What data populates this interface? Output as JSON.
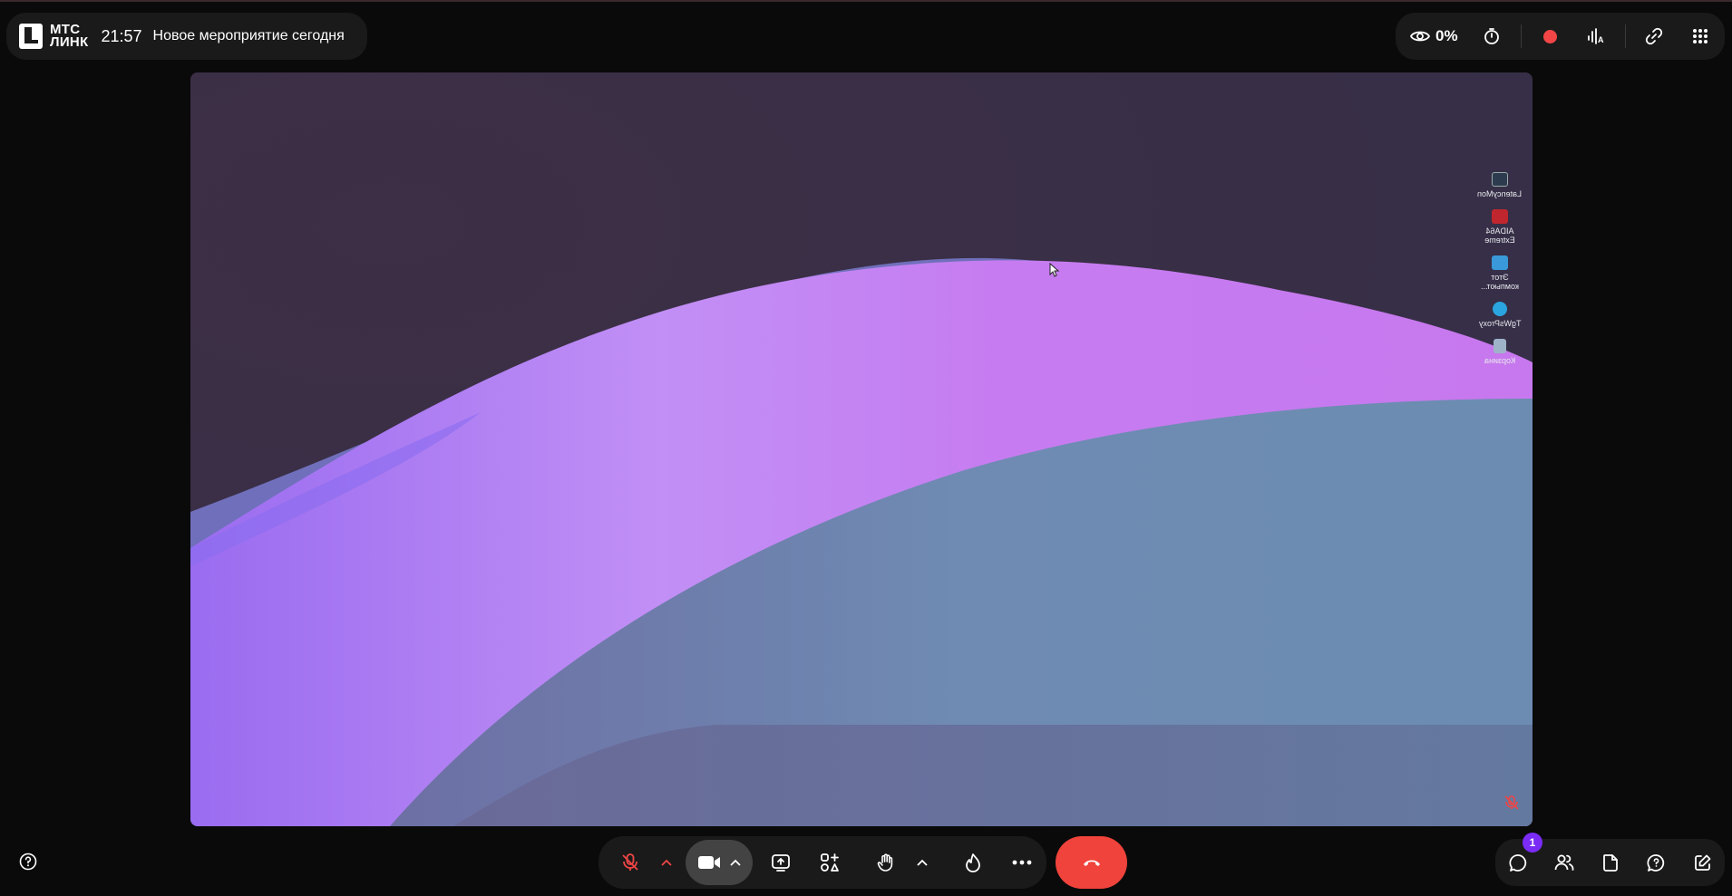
{
  "app": {
    "logo_text": "МТС\nЛИНК",
    "time": "21:57",
    "event_title": "Новое мероприятие сегодня"
  },
  "top_right": {
    "viewers_percent": "0%",
    "record_color": "#f24646"
  },
  "desktop_icons": [
    {
      "label": "LatencyMon",
      "icon": "latencymon-icon",
      "color": "#2d3b4e"
    },
    {
      "label": "AIDA64 Extreme",
      "icon": "aida64-icon",
      "color": "#c0262d"
    },
    {
      "label": "Этот компьют...",
      "icon": "this-pc-icon",
      "color": "#3a9ad9"
    },
    {
      "label": "TgWsProxy",
      "icon": "telegram-icon",
      "color": "#2aa5e0"
    },
    {
      "label": "Корзина",
      "icon": "recycle-bin-icon",
      "color": "#9fb3c8"
    }
  ],
  "bottom": {
    "chat_unread_count": "1",
    "end_call_color": "#f0433c",
    "mic_muted_color": "#f04646",
    "badge_color": "#7a2cf5"
  }
}
